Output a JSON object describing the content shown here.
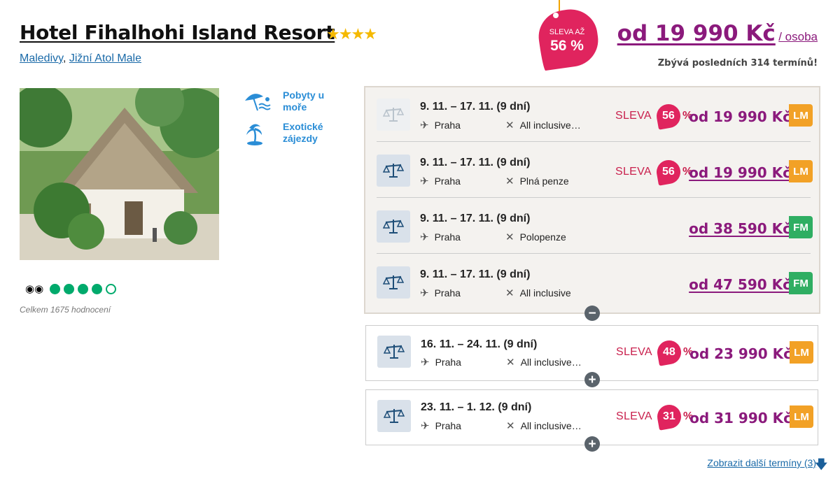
{
  "hotel": {
    "name": "Hotel Fihalhohi Island Resort",
    "stars": "★★★★",
    "country": "Maledivy",
    "region": "Jižní Atol Male"
  },
  "sale_tag": {
    "line1": "SLEVA AŽ",
    "line2": "56 %"
  },
  "headline": {
    "price": "od 19 990 Kč",
    "per": "/ osoba",
    "remaining": "Zbývá posledních 314 termínů!"
  },
  "categories": [
    {
      "label": "Pobyty u moře",
      "icon": "beach-umbrella-icon"
    },
    {
      "label": "Exotické zájezdy",
      "icon": "palm-island-icon"
    }
  ],
  "rating": {
    "provider_icon": "tripadvisor-owl-icon",
    "score": 4,
    "max": 5,
    "count_text": "Celkem 1675 hodnocení"
  },
  "terms_expanded": [
    {
      "date": "9. 11. – 17. 11. (9 dní)",
      "from": "Praha",
      "board": "All inclusive…",
      "sale_label": "SLEVA",
      "discount": "56",
      "pct": "%",
      "price": "od 19 990 Kč",
      "badge": "LM"
    },
    {
      "date": "9. 11. – 17. 11. (9 dní)",
      "from": "Praha",
      "board": "Plná penze",
      "sale_label": "SLEVA",
      "discount": "56",
      "pct": "%",
      "price": "od 19 990 Kč",
      "badge": "LM"
    },
    {
      "date": "9. 11. – 17. 11. (9 dní)",
      "from": "Praha",
      "board": "Polopenze",
      "price": "od 38 590 Kč",
      "badge": "FM"
    },
    {
      "date": "9. 11. – 17. 11. (9 dní)",
      "from": "Praha",
      "board": "All inclusive",
      "price": "od 47 590 Kč",
      "badge": "FM"
    }
  ],
  "terms_collapsed": [
    {
      "date": "16. 11. – 24. 11. (9 dní)",
      "from": "Praha",
      "board": "All inclusive…",
      "sale_label": "SLEVA",
      "discount": "48",
      "pct": "%",
      "price": "od 23 990 Kč",
      "badge": "LM"
    },
    {
      "date": "23. 11. – 1. 12. (9 dní)",
      "from": "Praha",
      "board": "All inclusive…",
      "sale_label": "SLEVA",
      "discount": "31",
      "pct": "%",
      "price": "od 31 990 Kč",
      "badge": "LM"
    }
  ],
  "more_terms": "Zobrazit další termíny (3)",
  "colors": {
    "price": "#8b1a7c",
    "sale": "#e0245e",
    "lm": "#f2a126",
    "fm": "#2fae62",
    "link": "#1a6aa8"
  }
}
